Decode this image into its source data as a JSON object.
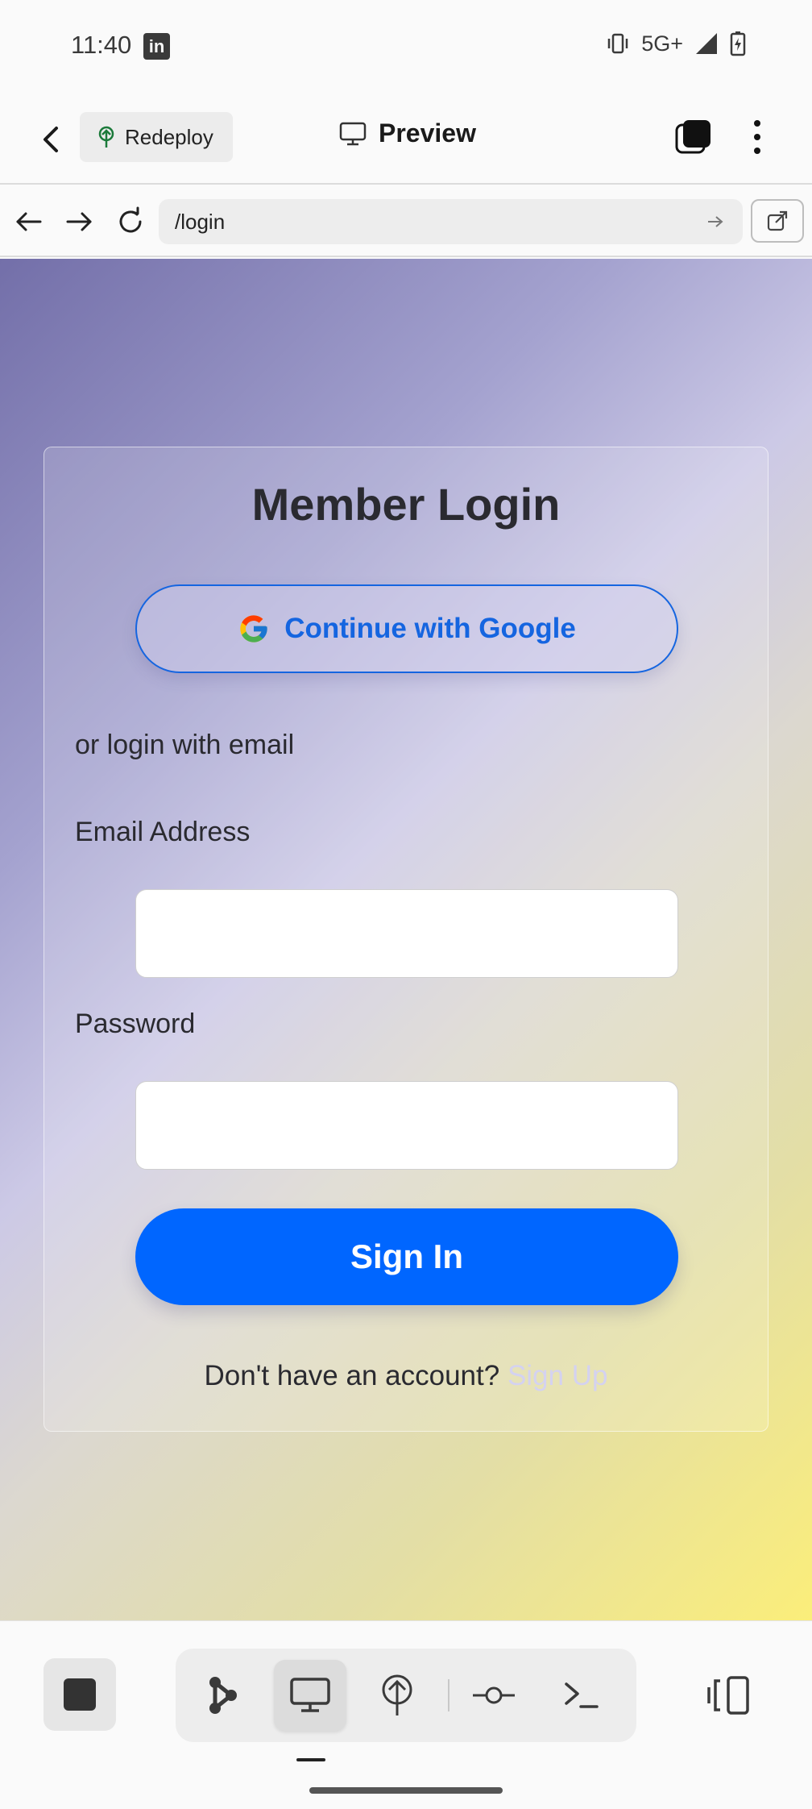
{
  "status_bar": {
    "time": "11:40",
    "app_icon": "in",
    "network": "5G+"
  },
  "app_bar": {
    "redeploy_label": "Redeploy",
    "title": "Preview"
  },
  "url_bar": {
    "url": "/login"
  },
  "login": {
    "title": "Member Login",
    "google_button": "Continue with Google",
    "or_text": "or login with email",
    "email_label": "Email Address",
    "email_value": "",
    "password_label": "Password",
    "password_value": "",
    "signin_button": "Sign In",
    "no_account_text": "Don't have an account?",
    "signup_link": "Sign Up"
  },
  "colors": {
    "primary": "#0066ff",
    "google_text": "#1565e0",
    "signup_link": "#d4d2f0",
    "gradient_start": "#736fa9",
    "gradient_end": "#fbee7a"
  },
  "toolbar_icons": [
    "stop-icon",
    "graph-nodes-icon",
    "monitor-icon",
    "deploy-icon",
    "commit-icon",
    "terminal-icon",
    "panel-toggle-icon"
  ]
}
